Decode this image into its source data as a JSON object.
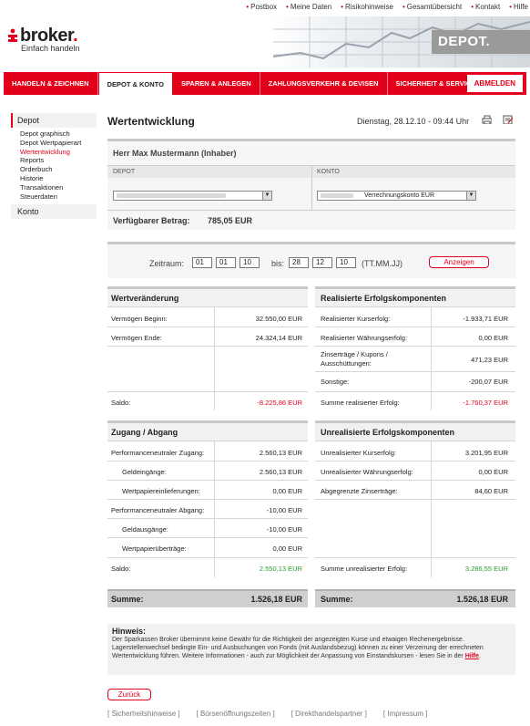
{
  "top_links": [
    "Postbox",
    "Meine Daten",
    "Risikohinweise",
    "Gesamtübersicht",
    "Kontakt",
    "Hilfe"
  ],
  "brand": {
    "name_part": "broker",
    "dot": ".",
    "tagline": "Einfach handeln",
    "banner_label": "DEPOT.",
    "accent": "#e2001a"
  },
  "nav": {
    "items": [
      "HANDELN & ZEICHNEN",
      "DEPOT & KONTO",
      "SPAREN & ANLEGEN",
      "ZAHLUNGSVERKEHR & DEVISEN",
      "SICHERHEIT & SERVICE"
    ],
    "active_index": 1,
    "logout": "ABMELDEN"
  },
  "sidebar": {
    "depot": "Depot",
    "sub": [
      "Depot graphisch",
      "Depot Wertpapierart",
      "Wertentwicklung",
      "Reports",
      "Orderbuch",
      "Historie",
      "Transaktionen",
      "Steuerdaten"
    ],
    "current_index": 2,
    "konto": "Konto"
  },
  "page": {
    "title": "Wertentwicklung",
    "date": "Dienstag, 28.12.10 - 09:44 Uhr",
    "print_icon": "printer-icon",
    "edit_icon": "notepad-icon"
  },
  "owner": {
    "name": "Herr Max Mustermann (Inhaber)",
    "depot_label": "DEPOT",
    "konto_label": "KONTO",
    "konto_select": "Verrechnungskonto EUR",
    "available_label": "Verfügbarer Betrag:",
    "available_value": "785,05 EUR"
  },
  "period": {
    "label": "Zeitraum:",
    "from": [
      "01",
      "01",
      "10"
    ],
    "to_label": "bis:",
    "to": [
      "28",
      "12",
      "10"
    ],
    "format": "(TT.MM.JJ)",
    "button": "Anzeigen"
  },
  "wert": {
    "title": "Wertveränderung",
    "begin_label": "Vermögen Beginn:",
    "begin": "32.550,00 EUR",
    "end_label": "Vermögen Ende:",
    "end": "24.324,14 EUR",
    "saldo_label": "Saldo:",
    "saldo": "-8.225,86 EUR"
  },
  "real": {
    "title": "Realisierte Erfolgskomponenten",
    "rows": [
      {
        "label": "Realisierter Kurserfolg:",
        "value": "-1.933,71 EUR"
      },
      {
        "label": "Realisierter Währungserfolg:",
        "value": "0,00 EUR"
      },
      {
        "label": "Zinserträge / Kupons / Ausschüttungen:",
        "value": "471,23 EUR"
      },
      {
        "label": "Sonstige:",
        "value": "-200,07 EUR"
      }
    ],
    "sum_label": "Summe realisierter Erfolg:",
    "sum": "-1.760,37 EUR"
  },
  "zugang": {
    "title": "Zugang / Abgang",
    "rows": [
      {
        "label": "Performanceneutraler Zugang:",
        "value": "2.560,13 EUR",
        "indent": false
      },
      {
        "label": "Geldeingänge:",
        "value": "2.560,13 EUR",
        "indent": true
      },
      {
        "label": "Wertpapiereinlieferungen:",
        "value": "0,00 EUR",
        "indent": true
      },
      {
        "label": "Performanceneutraler Abgang:",
        "value": "-10,00 EUR",
        "indent": false
      },
      {
        "label": "Geldausgänge:",
        "value": "-10,00 EUR",
        "indent": true
      },
      {
        "label": "Wertpapierüberträge:",
        "value": "0,00 EUR",
        "indent": true
      }
    ],
    "saldo_label": "Saldo:",
    "saldo": "2.550,13 EUR"
  },
  "unreal": {
    "title": "Unrealisierte Erfolgskomponenten",
    "rows": [
      {
        "label": "Unrealisierter Kurserfolg:",
        "value": "3.201,95 EUR"
      },
      {
        "label": "Unrealisierter Währungserfolg:",
        "value": "0,00 EUR"
      },
      {
        "label": "Abgegrenzte Zinserträge:",
        "value": "84,60 EUR"
      }
    ],
    "sum_label": "Summe unrealisierter Erfolg:",
    "sum": "3.286,55 EUR"
  },
  "summe": {
    "label": "Summe:",
    "left": "1.526,18 EUR",
    "right": "1.526,18 EUR"
  },
  "hinweis": {
    "title": "Hinweis:",
    "text": "Der Sparkassen Broker übernimmt keine Gewähr für die Richtigkeit der angezeigten Kurse und etwaigen Rechenergebnisse. Lagerstellenwechsel bedingte Ein- und Ausbuchungen von Fonds (mit Auslandsbezug) können zu einer Verzerrung der errechneten Wertentwicklung führen. Weitere Informationen - auch zur Möglichkeit der Anpassung von Einstandskursen - lesen Sie in der",
    "link": "Hilfe",
    "end": "."
  },
  "back_button": "Zurück",
  "footer": [
    "[ Sicherheitshinweise ]",
    "[ Börsenöffnungszeiten ]",
    "[ Direkthandelspartner ]",
    "[ Impressum ]"
  ]
}
